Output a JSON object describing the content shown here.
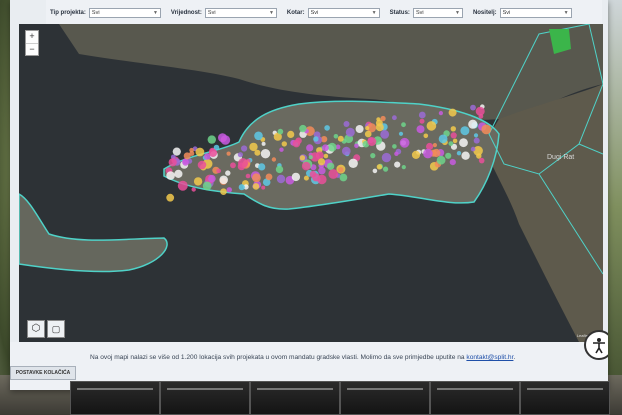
{
  "filters": [
    {
      "label": "Tip projekta:",
      "value": "Svi"
    },
    {
      "label": "Vrijednost:",
      "value": "Svi"
    },
    {
      "label": "Kotar:",
      "value": "Svi"
    },
    {
      "label": "Status:",
      "value": "Svi"
    },
    {
      "label": "Nositelj:",
      "value": "Svi"
    }
  ],
  "map": {
    "zoom_in": "+",
    "zoom_out": "−",
    "labels": [
      "Dugi Rat"
    ],
    "attribution": "Leaflet | Esri",
    "marker_colors": [
      "#e94f9a",
      "#f2c94c",
      "#9b6bd6",
      "#5ec8e5",
      "#f28c5a",
      "#f4f4f4",
      "#6fd38b",
      "#c85ae0"
    ]
  },
  "caption": {
    "text": "Na ovoj mapi nalazi se više od 1.200 lokacija svih projekata u ovom mandatu gradske vlasti. Molimo da sve primjedbe uputite na ",
    "link": "kontakt@split.hr",
    "end": "."
  },
  "footer": {
    "cookie_button": "POSTAVKE KOLAČIĆA"
  },
  "colors": {
    "land_outline": "#4fd2c8",
    "accent": "#1f4fa8"
  }
}
